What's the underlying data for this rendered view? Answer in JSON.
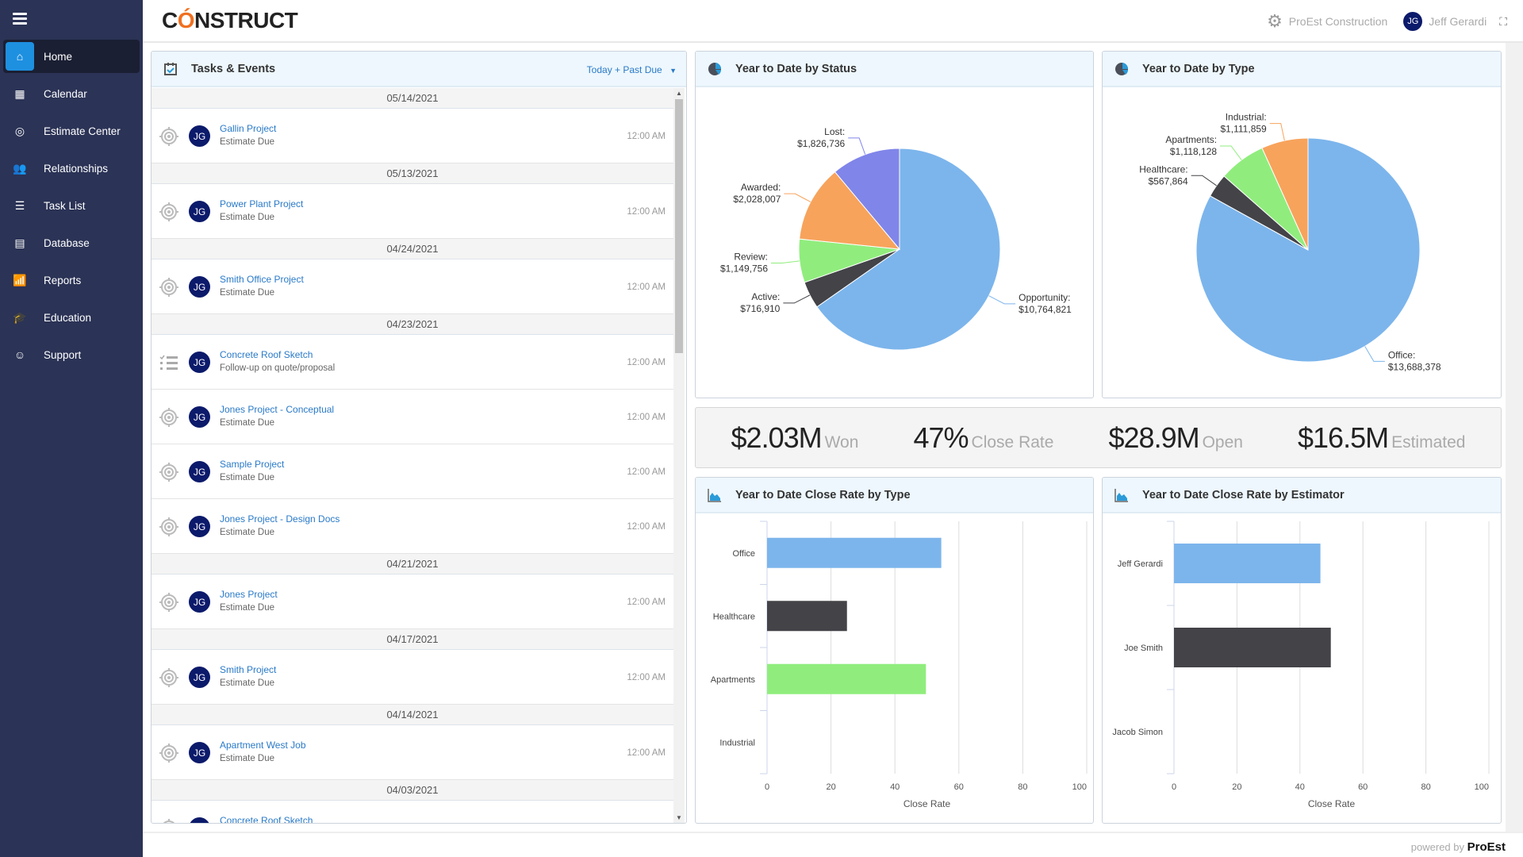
{
  "sidebar": {
    "items": [
      {
        "label": "Home",
        "icon": "home-icon",
        "active": true
      },
      {
        "label": "Calendar",
        "icon": "calendar-icon"
      },
      {
        "label": "Estimate Center",
        "icon": "target-icon"
      },
      {
        "label": "Relationships",
        "icon": "users-icon"
      },
      {
        "label": "Task List",
        "icon": "task-list-icon"
      },
      {
        "label": "Database",
        "icon": "database-icon"
      },
      {
        "label": "Reports",
        "icon": "reports-icon"
      },
      {
        "label": "Education",
        "icon": "graduation-cap-icon"
      },
      {
        "label": "Support",
        "icon": "support-icon"
      }
    ]
  },
  "header": {
    "logo": "CONSTRUCT",
    "company": "ProEst Construction",
    "user_initials": "JG",
    "user_name": "Jeff Gerardi"
  },
  "tasks": {
    "title": "Tasks & Events",
    "filter": "Today + Past Due",
    "groups": [
      {
        "date": "05/14/2021",
        "items": [
          {
            "title": "Gallin Project",
            "subtitle": "Estimate Due",
            "time": "12:00 AM",
            "type": "estimate",
            "initials": "JG"
          }
        ]
      },
      {
        "date": "05/13/2021",
        "items": [
          {
            "title": "Power Plant Project",
            "subtitle": "Estimate Due",
            "time": "12:00 AM",
            "type": "estimate",
            "initials": "JG"
          }
        ]
      },
      {
        "date": "04/24/2021",
        "items": [
          {
            "title": "Smith Office Project",
            "subtitle": "Estimate Due",
            "time": "12:00 AM",
            "type": "estimate",
            "initials": "JG"
          }
        ]
      },
      {
        "date": "04/23/2021",
        "items": [
          {
            "title": "Concrete Roof Sketch",
            "subtitle": "Follow-up on quote/proposal",
            "time": "12:00 AM",
            "type": "task",
            "initials": "JG"
          },
          {
            "title": "Jones Project - Conceptual",
            "subtitle": "Estimate Due",
            "time": "12:00 AM",
            "type": "estimate",
            "initials": "JG"
          },
          {
            "title": "Sample Project",
            "subtitle": "Estimate Due",
            "time": "12:00 AM",
            "type": "estimate",
            "initials": "JG"
          },
          {
            "title": "Jones Project - Design Docs",
            "subtitle": "Estimate Due",
            "time": "12:00 AM",
            "type": "estimate",
            "initials": "JG"
          }
        ]
      },
      {
        "date": "04/21/2021",
        "items": [
          {
            "title": "Jones Project",
            "subtitle": "Estimate Due",
            "time": "12:00 AM",
            "type": "estimate",
            "initials": "JG"
          }
        ]
      },
      {
        "date": "04/17/2021",
        "items": [
          {
            "title": "Smith Project",
            "subtitle": "Estimate Due",
            "time": "12:00 AM",
            "type": "estimate",
            "initials": "JG"
          }
        ]
      },
      {
        "date": "04/14/2021",
        "items": [
          {
            "title": "Apartment West Job",
            "subtitle": "Estimate Due",
            "time": "12:00 AM",
            "type": "estimate",
            "initials": "JG"
          }
        ]
      },
      {
        "date": "04/03/2021",
        "items": [
          {
            "title": "Concrete Roof Sketch",
            "type": "estimate",
            "initials": "JG"
          }
        ]
      }
    ]
  },
  "kpis": [
    {
      "value": "$2.03M",
      "label": "Won"
    },
    {
      "value": "47%",
      "label": "Close Rate"
    },
    {
      "value": "$28.9M",
      "label": "Open"
    },
    {
      "value": "$16.5M",
      "label": "Estimated"
    }
  ],
  "footer": {
    "powered": "powered by",
    "brand": "ProEst"
  },
  "colors": {
    "blue": "#7cb5ec",
    "dark": "#434348",
    "green": "#90ed7d",
    "orange": "#f7a35c",
    "purple": "#8085e9",
    "sidebar": "#2b3356",
    "accent": "#1e90e0"
  },
  "chart_data": [
    {
      "type": "pie",
      "title": "Year to Date by Status",
      "slices": [
        {
          "label": "Opportunity",
          "value": 10764821,
          "display": "$10,764,821",
          "color": "#7cb5ec"
        },
        {
          "label": "Active",
          "value": 716910,
          "display": "$716,910",
          "color": "#434348"
        },
        {
          "label": "Review",
          "value": 1149756,
          "display": "$1,149,756",
          "color": "#90ed7d"
        },
        {
          "label": "Awarded",
          "value": 2028007,
          "display": "$2,028,007",
          "color": "#f7a35c"
        },
        {
          "label": "Lost",
          "value": 1826736,
          "display": "$1,826,736",
          "color": "#8085e9"
        }
      ]
    },
    {
      "type": "pie",
      "title": "Year to Date by Type",
      "slices": [
        {
          "label": "Office",
          "value": 13688378,
          "display": "$13,688,378",
          "color": "#7cb5ec"
        },
        {
          "label": "Healthcare",
          "value": 567864,
          "display": "$567,864",
          "color": "#434348"
        },
        {
          "label": "Apartments",
          "value": 1118128,
          "display": "$1,118,128",
          "color": "#90ed7d"
        },
        {
          "label": "Industrial",
          "value": 1111859,
          "display": "$1,111,859",
          "color": "#f7a35c"
        }
      ]
    },
    {
      "type": "bar",
      "orientation": "horizontal",
      "title": "Year to Date Close Rate by Type",
      "categories": [
        "Office",
        "Healthcare",
        "Apartments",
        "Industrial"
      ],
      "values": [
        54.5,
        25,
        49.7,
        0
      ],
      "colors": [
        "#7cb5ec",
        "#434348",
        "#90ed7d",
        "#f7a35c"
      ],
      "xlabel": "Close Rate",
      "xlim": [
        0,
        100
      ],
      "xticks": [
        0,
        20,
        40,
        60,
        80,
        100
      ],
      "grid": true
    },
    {
      "type": "bar",
      "orientation": "horizontal",
      "title": "Year to Date Close Rate by Estimator",
      "categories": [
        "Jeff Gerardi",
        "Joe Smith",
        "Jacob Simon"
      ],
      "values": [
        46.5,
        49.8,
        0
      ],
      "colors": [
        "#7cb5ec",
        "#434348",
        "#90ed7d"
      ],
      "xlabel": "Close Rate",
      "xlim": [
        0,
        100
      ],
      "xticks": [
        0,
        20,
        40,
        60,
        80,
        100
      ],
      "grid": true
    }
  ]
}
